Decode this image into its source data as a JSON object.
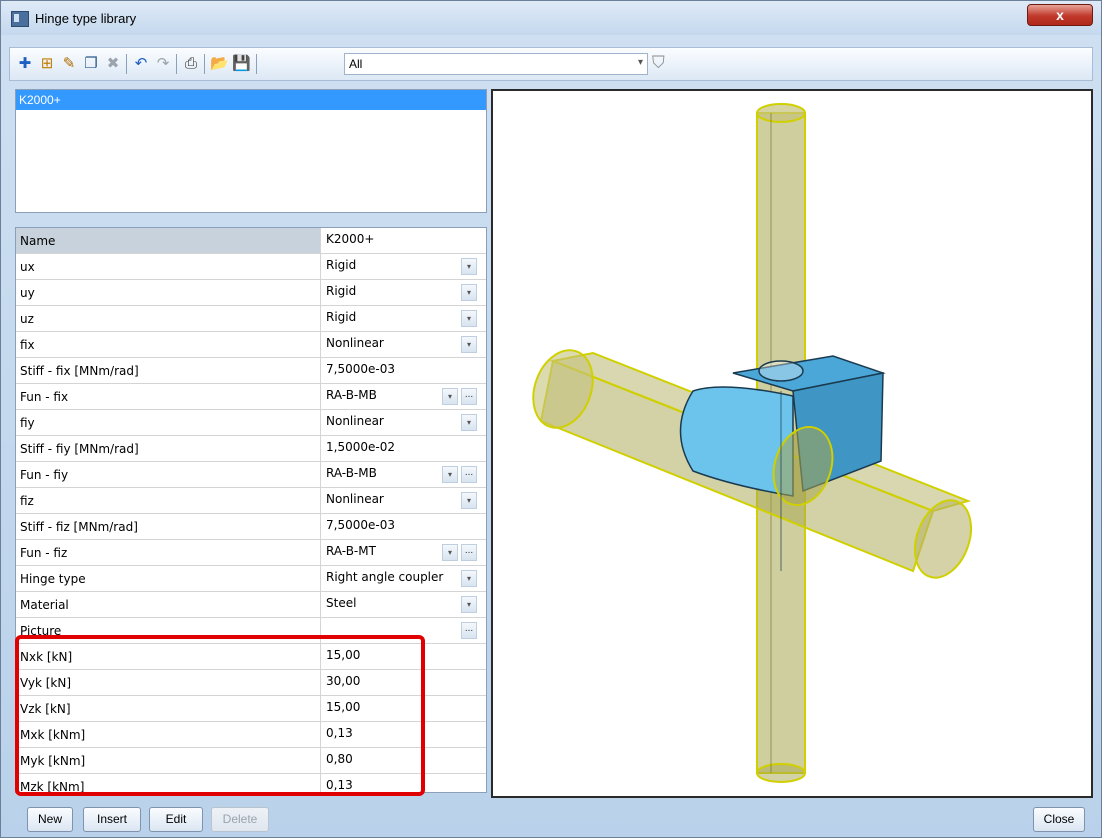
{
  "window": {
    "title": "Hinge type library",
    "close_glyph": "x"
  },
  "toolbar": {
    "icons": [
      "new-icon",
      "insert-icon",
      "edit-icon",
      "copy-icon",
      "delete-icon",
      "undo-icon",
      "redo-icon",
      "print-icon",
      "open-icon",
      "save-icon"
    ],
    "filter_value": "All",
    "filter_arrow": "▾",
    "funnel_glyph": "⛉"
  },
  "list": {
    "items": [
      "K2000+"
    ]
  },
  "properties": {
    "rows": [
      {
        "name": "Name",
        "value": "K2000+"
      },
      {
        "name": "ux",
        "value": "Rigid"
      },
      {
        "name": "uy",
        "value": "Rigid"
      },
      {
        "name": "uz",
        "value": "Rigid"
      },
      {
        "name": "fix",
        "value": "Nonlinear"
      },
      {
        "name": "Stiff - fix [MNm/rad]",
        "value": "7,5000e-03"
      },
      {
        "name": "Fun -  fix",
        "value": "RA-B-MB"
      },
      {
        "name": "fiy",
        "value": "Nonlinear"
      },
      {
        "name": "Stiff - fiy [MNm/rad]",
        "value": "1,5000e-02"
      },
      {
        "name": "Fun -  fiy",
        "value": "RA-B-MB"
      },
      {
        "name": "fiz",
        "value": "Nonlinear"
      },
      {
        "name": "Stiff - fiz [MNm/rad]",
        "value": "7,5000e-03"
      },
      {
        "name": "Fun -  fiz",
        "value": "RA-B-MT"
      },
      {
        "name": "Hinge type",
        "value": "Right angle coupler"
      },
      {
        "name": "Material",
        "value": "Steel"
      },
      {
        "name": "Picture",
        "value": ""
      },
      {
        "name": "Nxk [kN]",
        "value": "15,00"
      },
      {
        "name": "Vyk [kN]",
        "value": "30,00"
      },
      {
        "name": "Vzk [kN]",
        "value": "15,00"
      },
      {
        "name": "Mxk [kNm]",
        "value": "0,13"
      },
      {
        "name": "Myk [kNm]",
        "value": "0,80"
      },
      {
        "name": "Mzk [kNm]",
        "value": "0,13"
      }
    ],
    "dropdown_glyph": "▾",
    "ellipsis_glyph": "..."
  },
  "buttons": {
    "new": "New",
    "insert": "Insert",
    "edit": "Edit",
    "delete": "Delete",
    "close": "Close"
  },
  "colors": {
    "selection": "#3399ff",
    "highlight_frame": "#e00000",
    "tube": "#a8a650",
    "coupler": "#5bb8e6"
  }
}
